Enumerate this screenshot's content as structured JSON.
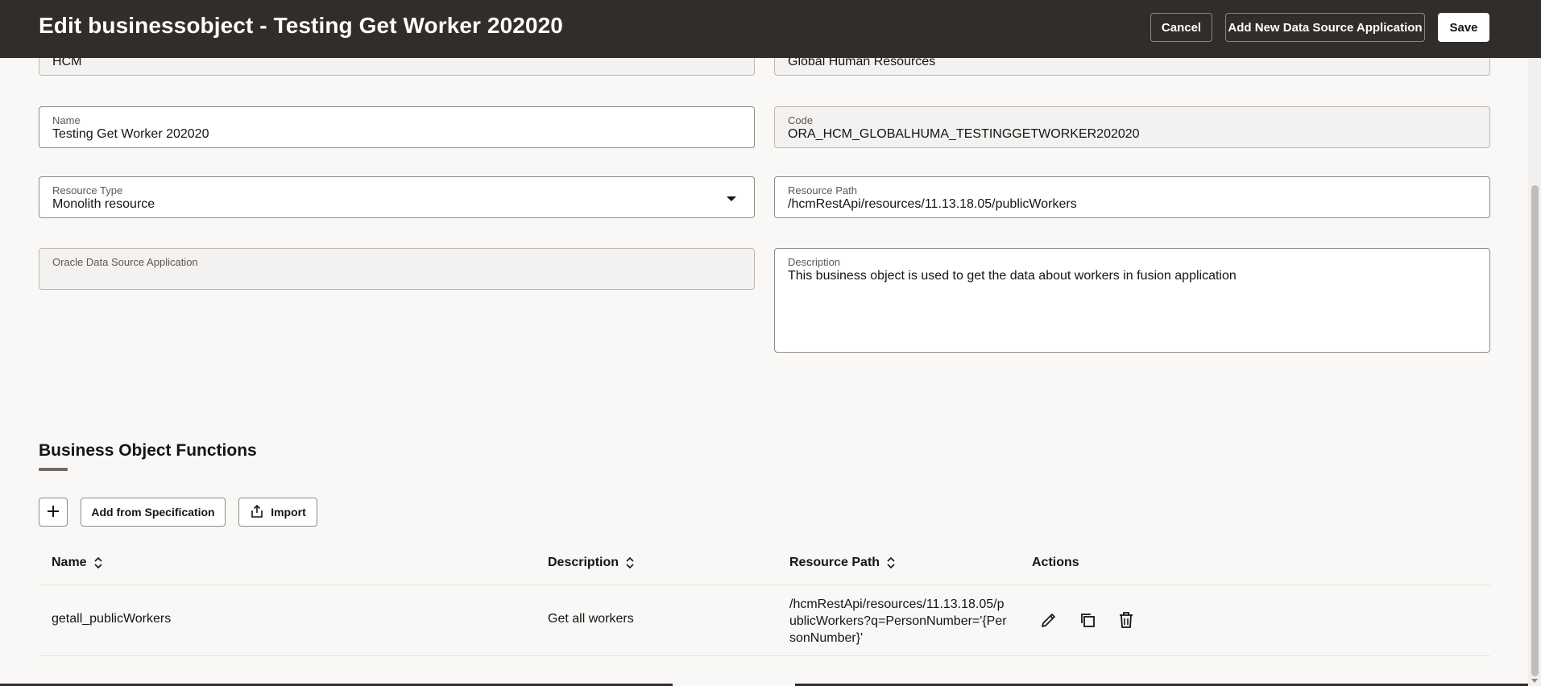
{
  "header": {
    "title": "Edit businessobject - Testing Get Worker 202020",
    "cancel_label": "Cancel",
    "add_app_label": "Add New Data Source Application",
    "save_label": "Save"
  },
  "form": {
    "family_value": "HCM",
    "product_value": "Global Human Resources",
    "name": {
      "label": "Name",
      "value": "Testing Get Worker 202020"
    },
    "code": {
      "label": "Code",
      "value": "ORA_HCM_GLOBALHUMA_TESTINGGETWORKER202020"
    },
    "resource_type": {
      "label": "Resource Type",
      "value": "Monolith resource"
    },
    "resource_path": {
      "label": "Resource Path",
      "value": "/hcmRestApi/resources/11.13.18.05/publicWorkers"
    },
    "oracle_app": {
      "label": "Oracle Data Source Application",
      "value": ""
    },
    "description": {
      "label": "Description",
      "value": "This business object is used to get the data about workers in fusion application"
    }
  },
  "functions": {
    "title": "Business Object Functions",
    "add_from_spec_label": "Add from Specification",
    "import_label": "Import",
    "columns": [
      "Name",
      "Description",
      "Resource Path",
      "Actions"
    ],
    "rows": [
      {
        "name": "getall_publicWorkers",
        "description": "Get all workers",
        "resource_path": "/hcmRestApi/resources/11.13.18.05/publicWorkers?q=PersonNumber='{PersonNumber}'",
        "actions": [
          "edit-icon",
          "duplicate-icon",
          "delete-icon"
        ]
      }
    ]
  }
}
